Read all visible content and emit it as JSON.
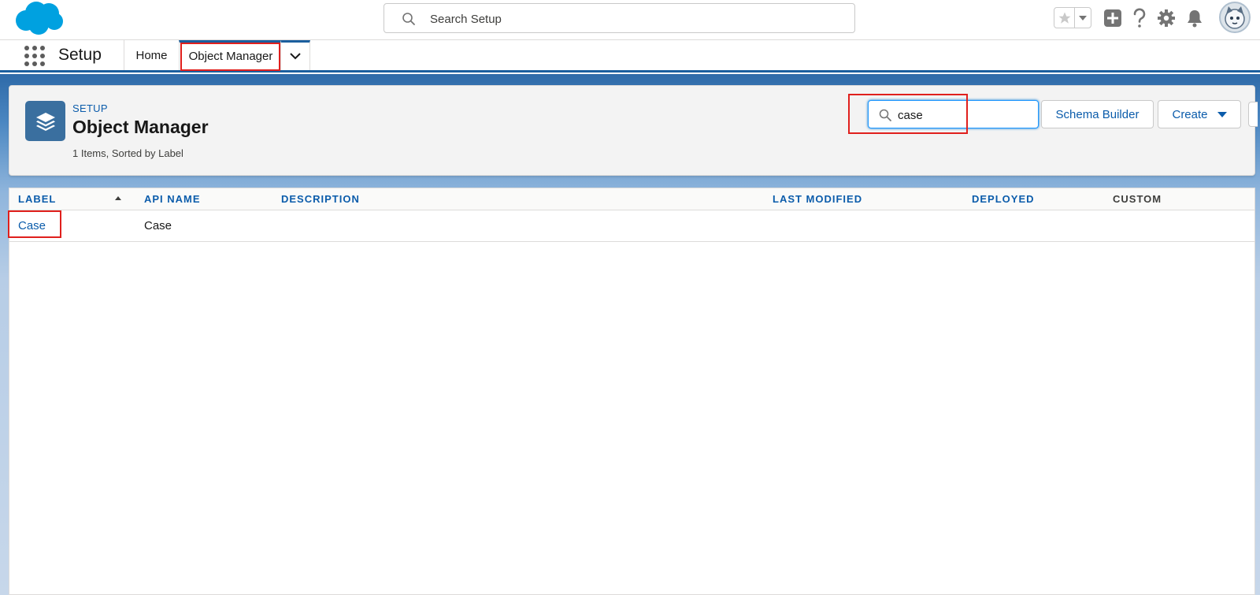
{
  "global_header": {
    "search_placeholder": "Search Setup",
    "icons": [
      "salesforce-cloud-logo",
      "favorites-star",
      "favorites-menu",
      "add-icon",
      "help-icon",
      "gear-icon",
      "bell-icon",
      "avatar"
    ]
  },
  "context_bar": {
    "app_name": "Setup",
    "tabs": [
      {
        "label": "Home"
      },
      {
        "label": "Object Manager",
        "active": true
      }
    ]
  },
  "page_header": {
    "eyebrow": "SETUP",
    "title": "Object Manager",
    "meta": "1 Items, Sorted by Label",
    "quick_find_value": "case",
    "schema_builder_label": "Schema Builder",
    "create_label": "Create"
  },
  "table": {
    "columns": [
      "LABEL",
      "API NAME",
      "DESCRIPTION",
      "LAST MODIFIED",
      "DEPLOYED",
      "CUSTOM"
    ],
    "sorted_by": "LABEL",
    "rows": [
      {
        "label": "Case",
        "api_name": "Case",
        "description": "",
        "last_modified": "",
        "deployed": "",
        "custom": ""
      }
    ]
  },
  "colors": {
    "brand_blue": "#0b5cab",
    "highlight_red": "#e0201d",
    "header_band": "#2e6aa8"
  }
}
